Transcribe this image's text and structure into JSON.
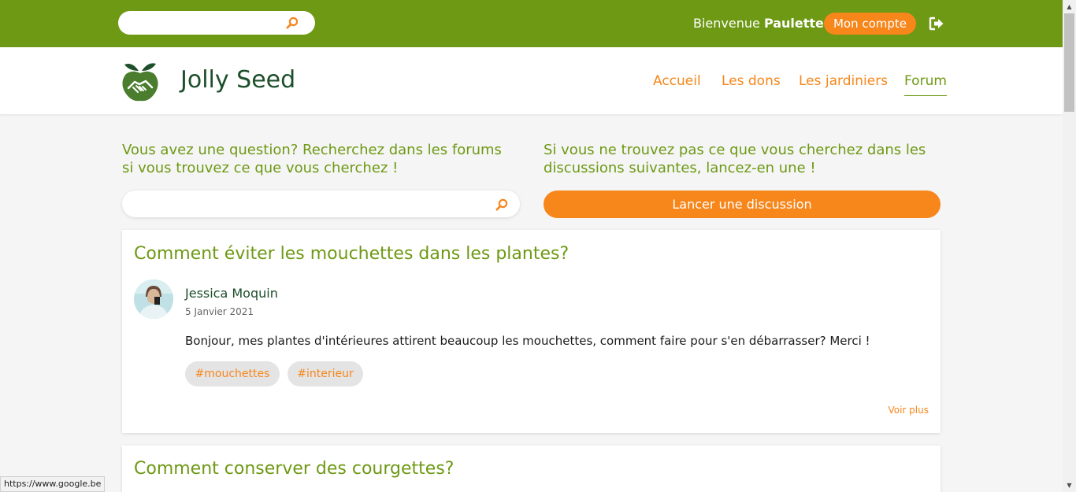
{
  "top_bar": {
    "search": {
      "value": "",
      "placeholder": ""
    },
    "welcome_prefix": "Bienvenue",
    "user_name": "Paulette",
    "account_label": "Mon compte"
  },
  "header": {
    "brand": "Jolly Seed",
    "nav": [
      {
        "label": "Accueil"
      },
      {
        "label": "Les dons"
      },
      {
        "label": "Les jardiniers"
      },
      {
        "label": "Forum",
        "active": true
      }
    ]
  },
  "forum": {
    "search_intro": "Vous avez une question? Recherchez dans les forums si vous trouvez ce que vous cherchez !",
    "launch_intro": "Si vous ne trouvez pas ce que vous cherchez dans les discussions suivantes, lancez-en une !",
    "search": {
      "value": "",
      "placeholder": ""
    },
    "launch_label": "Lancer une discussion"
  },
  "posts": [
    {
      "title": "Comment éviter les mouchettes dans les plantes?",
      "author": "Jessica Moquin",
      "date": "5 Janvier 2021",
      "body": "Bonjour, mes plantes d'intérieures attirent beaucoup les mouchettes, comment faire pour s'en débarrasser? Merci !",
      "tags": [
        "#mouchettes",
        "#interieur"
      ],
      "more_label": "Voir plus"
    },
    {
      "title": "Comment conserver des courgettes?"
    }
  ],
  "status_bar": {
    "url": "https://www.google.be"
  },
  "colors": {
    "green": "#6e9914",
    "dark_green": "#1c4f2a",
    "orange": "#f7861b"
  },
  "icons": {
    "search": "magnifier-icon",
    "logout": "logout-icon",
    "logo": "apple-handshake-logo"
  }
}
